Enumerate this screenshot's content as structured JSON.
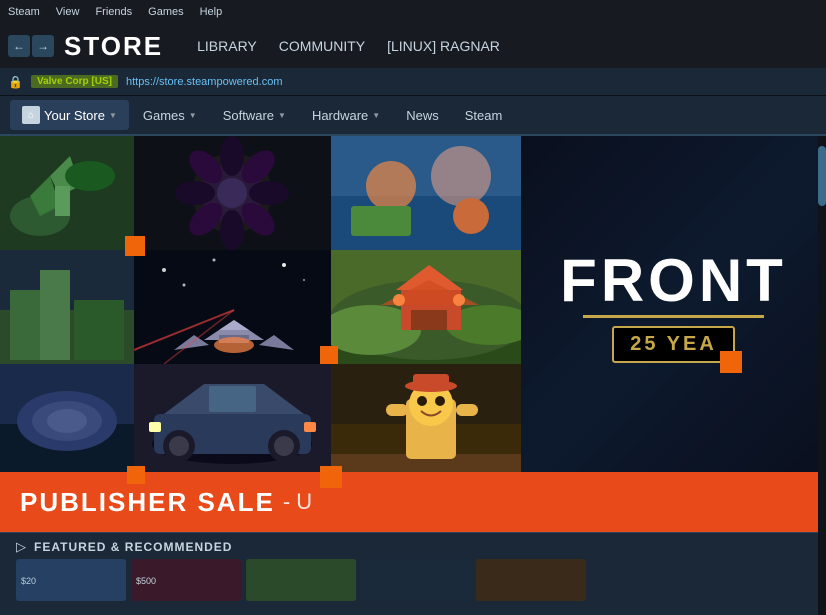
{
  "menubar": {
    "items": [
      "Steam",
      "View",
      "Friends",
      "Games",
      "Help"
    ]
  },
  "navbar": {
    "back_label": "←",
    "forward_label": "→",
    "store_label": "STORE",
    "links": [
      "LIBRARY",
      "COMMUNITY",
      "[LINUX] RAGNAR"
    ]
  },
  "addressbar": {
    "badge_label": "Valve Corp [US]",
    "url": "https://store.steampowered.com"
  },
  "storenav": {
    "items": [
      {
        "label": "Your Store",
        "has_icon": true,
        "has_chevron": true
      },
      {
        "label": "Games",
        "has_chevron": true
      },
      {
        "label": "Software",
        "has_chevron": true
      },
      {
        "label": "Hardware",
        "has_chevron": true
      },
      {
        "label": "News",
        "has_chevron": false
      },
      {
        "label": "Steam",
        "has_chevron": false
      }
    ]
  },
  "featured_banner": {
    "logo_text": "FRONT",
    "years_text": "25 YEA",
    "sale_text": "PUBLISHER SALE",
    "sale_suffix": "- U"
  },
  "featured_section": {
    "icon": "▷",
    "title": "FEATURED & RECOMMENDED"
  },
  "colors": {
    "orange_accent": "#f1650a",
    "sale_bg": "#e84a1a",
    "nav_bg": "#171a21",
    "store_bg": "#1b2838"
  }
}
